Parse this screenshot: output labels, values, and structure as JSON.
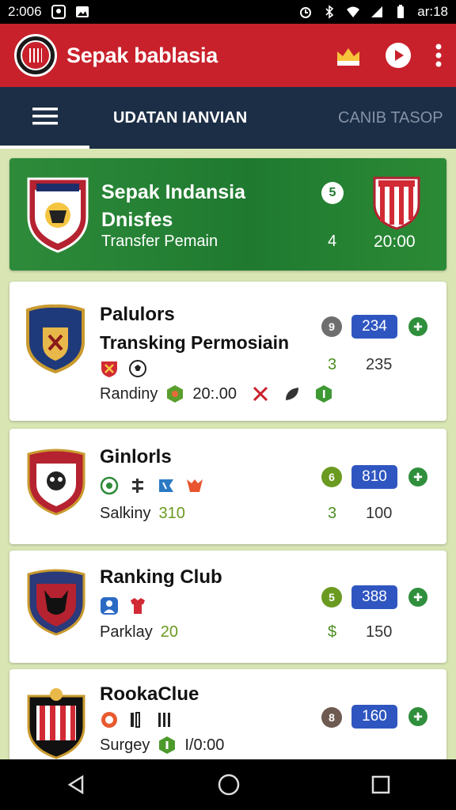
{
  "status_bar": {
    "time_left": "2:006",
    "time_right": "ar:18"
  },
  "app": {
    "title": "Sepak bablasia"
  },
  "tabs": {
    "active": "UDATAN IANVIAN",
    "inactive": "CANIB TASOP"
  },
  "featured": {
    "name_line1": "Sepak Indansia",
    "name_line2": "Dnisfes",
    "subtitle": "Transfer Pemain",
    "badge": "5",
    "count": "4",
    "time": "20:00"
  },
  "clubs": [
    {
      "name": "Palulors",
      "subtitle": "Transking Permosiain",
      "meta_label": "Randiny",
      "meta_value": "20:.00",
      "rank_badge": "9",
      "pill": "234",
      "rank": "3",
      "score": "235"
    },
    {
      "name": "Ginlorls",
      "meta_label": "Salkiny",
      "meta_value": "310",
      "rank_badge": "6",
      "pill": "810",
      "rank": "3",
      "score": "100"
    },
    {
      "name": "Ranking Club",
      "meta_label": "Parklay",
      "meta_value": "20",
      "rank_badge": "5",
      "pill": "388",
      "rank": "$",
      "score": "150"
    },
    {
      "name": "RookaClue",
      "meta_label": "Surgey",
      "meta_value": "I/0:00",
      "rank_badge": "8",
      "pill": "160"
    }
  ],
  "colors": {
    "app_bar": "#c8212b",
    "tab_bar": "#1c2e46",
    "featured": "#1f7a30",
    "pill": "#2f56c0",
    "background": "#d9e6b4"
  },
  "icons": [
    "crown-icon",
    "play-icon",
    "more-icon",
    "menu-icon",
    "back-icon",
    "home-icon",
    "recents-icon"
  ]
}
